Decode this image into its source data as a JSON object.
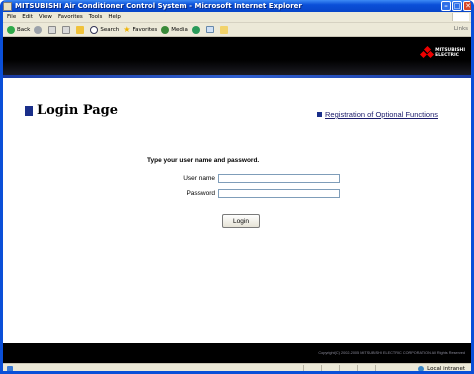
{
  "window": {
    "title": "MITSUBISHI Air Conditioner Control System - Microsoft Internet Explorer",
    "buttons": {
      "minimize": "–",
      "maximize": "□",
      "close": "✕"
    }
  },
  "menu": [
    "File",
    "Edit",
    "View",
    "Favorites",
    "Tools",
    "Help"
  ],
  "toolbar": {
    "back": "Back",
    "search": "Search",
    "favorites": "Favorites",
    "media": "Media",
    "links": "Links"
  },
  "brand": {
    "logo_line1": "MITSUBISHI",
    "logo_line2": "ELECTRIC",
    "accent_color": "#e00000",
    "banner_color": "#000000",
    "stripe_color": "#2f5fd0"
  },
  "page": {
    "title": "Login Page",
    "registration_link": "Registration of Optional Functions",
    "prompt": "Type your user name and password.",
    "username_label": "User name",
    "username_value": "",
    "password_label": "Password",
    "password_value": "",
    "login_button": "Login",
    "copyright": "Copyright(C) 2002-2005 MITSUBISHI ELECTRIC CORPORATION All Rights Reserved"
  },
  "status": {
    "zone": "Local intranet"
  },
  "icons": {
    "back": "back-arrow-icon",
    "forward": "forward-arrow-icon",
    "stop": "stop-icon",
    "refresh": "refresh-icon",
    "home": "home-icon",
    "search": "search-icon",
    "favorites": "star-icon",
    "media": "media-icon",
    "history": "history-icon",
    "mail": "mail-icon",
    "folder": "folder-icon"
  }
}
